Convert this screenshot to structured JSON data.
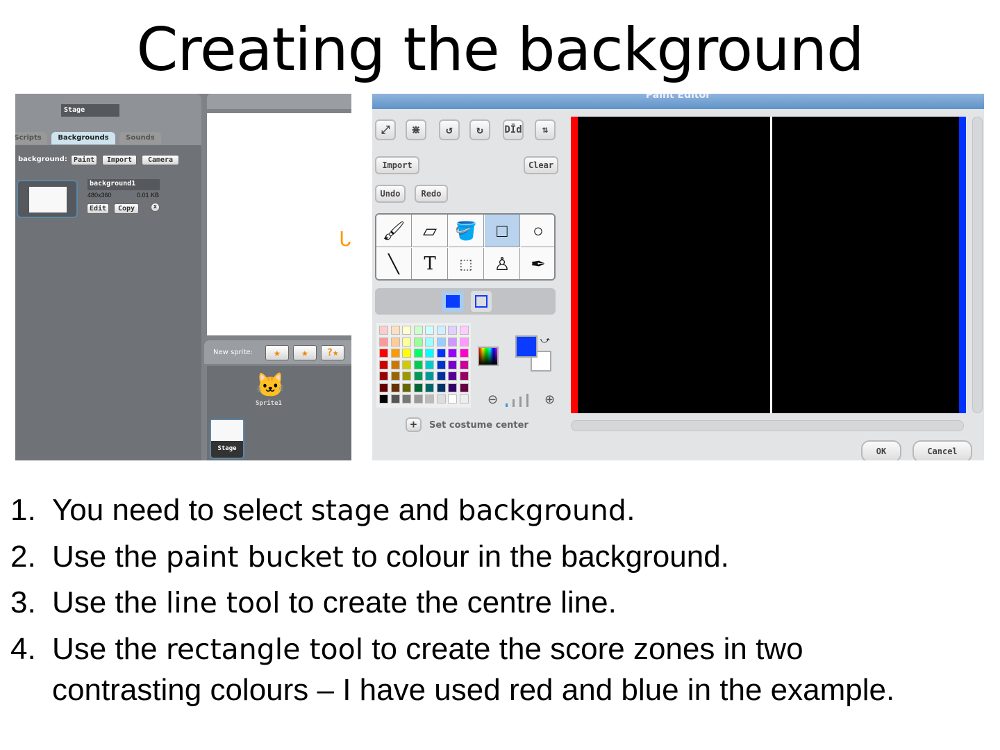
{
  "title": "Creating the background",
  "left": {
    "sprite_name": "Stage",
    "tabs": [
      "Scripts",
      "Backgrounds",
      "Sounds"
    ],
    "new_background_label": "background:",
    "buttons": [
      "Paint",
      "Import",
      "Camera"
    ],
    "costume": {
      "name": "background1",
      "size": "480x360",
      "filesize": "0.01 KB",
      "edit": "Edit",
      "copy": "Copy",
      "delete": "x"
    },
    "new_sprite_label": "New sprite:",
    "sprite1": "Sprite1",
    "stage_label": "Stage"
  },
  "paint_editor": {
    "title": "Paint Editor",
    "import": "Import",
    "clear": "Clear",
    "undo": "Undo",
    "redo": "Redo",
    "tools_row1": [
      "✎",
      "▱",
      "🪣",
      "□",
      "○"
    ],
    "tools_row2": [
      "╲",
      "T",
      "⬚",
      "♙",
      "✒"
    ],
    "selected_tool": "rectangle",
    "set_center": "Set costume center",
    "ok": "OK",
    "cancel": "Cancel",
    "colors": {
      "foreground": "#0a3cff",
      "background": "#ffffff",
      "left_zone": "#ff0000",
      "right_zone": "#0033ff",
      "canvas": "#000000",
      "centre_line": "#ffffff"
    },
    "palette": [
      [
        "#fcc",
        "#fde0c0",
        "#ffc",
        "#cfc",
        "#cff",
        "#ccf0ff",
        "#e0d0ff",
        "#fcf"
      ],
      [
        "#f99",
        "#fc9",
        "#ff9",
        "#9f9",
        "#9ff",
        "#99ccff",
        "#c9f",
        "#f9f"
      ],
      [
        "#f00",
        "#f90",
        "#ff0",
        "#0f6",
        "#0ff",
        "#03f",
        "#90f",
        "#f0c"
      ],
      [
        "#c00",
        "#c70",
        "#cc0",
        "#0c5",
        "#0cc",
        "#03c",
        "#70c",
        "#c09"
      ],
      [
        "#900",
        "#960",
        "#990",
        "#095",
        "#099",
        "#039",
        "#509",
        "#906"
      ],
      [
        "#600",
        "#630",
        "#660",
        "#063",
        "#066",
        "#036",
        "#306",
        "#604"
      ],
      [
        "#000",
        "#555",
        "#777",
        "#999",
        "#bbb",
        "#ddd",
        "#fff",
        "#eee"
      ]
    ]
  },
  "steps": [
    {
      "n": "1.",
      "parts": [
        [
          "You need to select ",
          0
        ],
        [
          "stage",
          1
        ],
        [
          " and ",
          0
        ],
        [
          "background.",
          1
        ]
      ]
    },
    {
      "n": "2.",
      "parts": [
        [
          "Use the ",
          0
        ],
        [
          "paint bucket",
          1
        ],
        [
          " to colour in the background.",
          0
        ]
      ]
    },
    {
      "n": "3.",
      "parts": [
        [
          "Use the ",
          0
        ],
        [
          "line tool",
          1
        ],
        [
          " to create the centre line.",
          0
        ]
      ]
    },
    {
      "n": "4.",
      "parts": [
        [
          "Use the ",
          0
        ],
        [
          "rectangle tool",
          1
        ],
        [
          " to create the score zones in two",
          0
        ]
      ]
    },
    {
      "n": "",
      "parts": [
        [
          "contrasting colours – I have used red and blue in the example.",
          0
        ]
      ]
    }
  ]
}
